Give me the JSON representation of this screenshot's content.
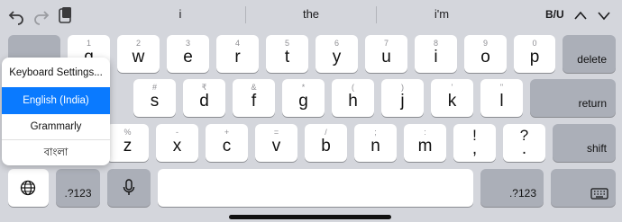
{
  "toolbar": {
    "undo_icon": "undo-arrow",
    "redo_icon": "redo-arrow",
    "clipboard_icon": "clipboard",
    "suggestions": [
      "i",
      "the",
      "i'm"
    ],
    "format_label": "B/U",
    "up_icon": "chevron-up",
    "down_icon": "chevron-down"
  },
  "row1": [
    {
      "hint": "1",
      "char": "q"
    },
    {
      "hint": "2",
      "char": "w"
    },
    {
      "hint": "3",
      "char": "e"
    },
    {
      "hint": "4",
      "char": "r"
    },
    {
      "hint": "5",
      "char": "t"
    },
    {
      "hint": "6",
      "char": "y"
    },
    {
      "hint": "7",
      "char": "u"
    },
    {
      "hint": "8",
      "char": "i"
    },
    {
      "hint": "9",
      "char": "o"
    },
    {
      "hint": "0",
      "char": "p"
    }
  ],
  "row2": [
    {
      "hint": "#",
      "char": "s"
    },
    {
      "hint": "₹",
      "char": "d"
    },
    {
      "hint": "&",
      "char": "f"
    },
    {
      "hint": "*",
      "char": "g"
    },
    {
      "hint": "(",
      "char": "h"
    },
    {
      "hint": ")",
      "char": "j"
    },
    {
      "hint": "'",
      "char": "k"
    },
    {
      "hint": "\"",
      "char": "l"
    }
  ],
  "row3": [
    {
      "hint": "%",
      "char": "z"
    },
    {
      "hint": "-",
      "char": "x"
    },
    {
      "hint": "+",
      "char": "c"
    },
    {
      "hint": "=",
      "char": "v"
    },
    {
      "hint": "/",
      "char": "b"
    },
    {
      "hint": ";",
      "char": "n"
    },
    {
      "hint": ":",
      "char": "m"
    },
    {
      "hint": "!",
      "char": ","
    },
    {
      "hint": "?",
      "char": "."
    }
  ],
  "keys": {
    "delete": "delete",
    "return": "return",
    "shift": "shift",
    "numbers_left": ".?123",
    "numbers_right": ".?123",
    "globe_icon": "globe",
    "mic_icon": "microphone",
    "keyboard_icon": "keyboard-dismiss"
  },
  "popup": {
    "items": [
      "Keyboard Settings...",
      "English (India)",
      "Grammarly",
      "বাংলা"
    ],
    "selected": "English (India)",
    "selected_color": "#0a7aff"
  }
}
